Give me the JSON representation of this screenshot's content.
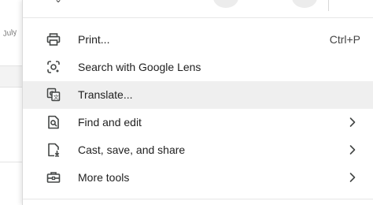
{
  "background": {
    "partial_label": "July"
  },
  "menu": {
    "items": [
      {
        "label": "Print...",
        "shortcut": "Ctrl+P",
        "icon": "printer-icon",
        "has_submenu": false,
        "highlighted": false
      },
      {
        "label": "Search with Google Lens",
        "shortcut": "",
        "icon": "google-lens-icon",
        "has_submenu": false,
        "highlighted": false
      },
      {
        "label": "Translate...",
        "shortcut": "",
        "icon": "translate-icon",
        "has_submenu": false,
        "highlighted": true
      },
      {
        "label": "Find and edit",
        "shortcut": "",
        "icon": "find-page-icon",
        "has_submenu": true,
        "highlighted": false
      },
      {
        "label": "Cast, save, and share",
        "shortcut": "",
        "icon": "cast-save-share-icon",
        "has_submenu": true,
        "highlighted": false
      },
      {
        "label": "More tools",
        "shortcut": "",
        "icon": "toolbox-icon",
        "has_submenu": true,
        "highlighted": false
      }
    ]
  },
  "colors": {
    "highlight": "#efefef",
    "text": "#1f1f1f",
    "icon": "#444746"
  }
}
